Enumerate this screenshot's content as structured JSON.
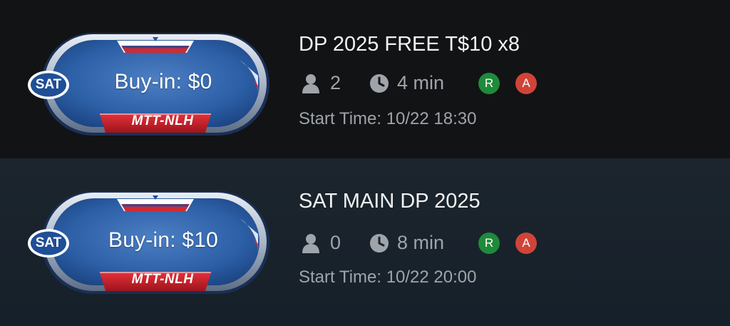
{
  "colors": {
    "row_top_bg": "#121315",
    "row_bottom_bg": "#1a232c",
    "badge_blue": "#2f62a8",
    "badge_red": "#c8222a",
    "registered_green": "#1f8a3a",
    "late_red": "#d04438",
    "text_primary": "#f2f2f2",
    "text_secondary": "#9ea4aa"
  },
  "tournaments": [
    {
      "badge_label": "SAT",
      "buy_in": "Buy-in: $0",
      "game_type": "MTT-NLH",
      "title": "DP 2025 FREE T$10 x8",
      "players": "2",
      "duration": "4 min",
      "status_r": "R",
      "status_a": "A",
      "start_time": "Start Time: 10/22 18:30",
      "icons": {
        "players": "person-icon",
        "duration": "clock-icon"
      }
    },
    {
      "badge_label": "SAT",
      "buy_in": "Buy-in: $10",
      "game_type": "MTT-NLH",
      "title": "SAT MAIN DP 2025",
      "players": "0",
      "duration": "8 min",
      "status_r": "R",
      "status_a": "A",
      "start_time": "Start Time: 10/22 20:00",
      "icons": {
        "players": "person-icon",
        "duration": "clock-icon"
      }
    }
  ]
}
